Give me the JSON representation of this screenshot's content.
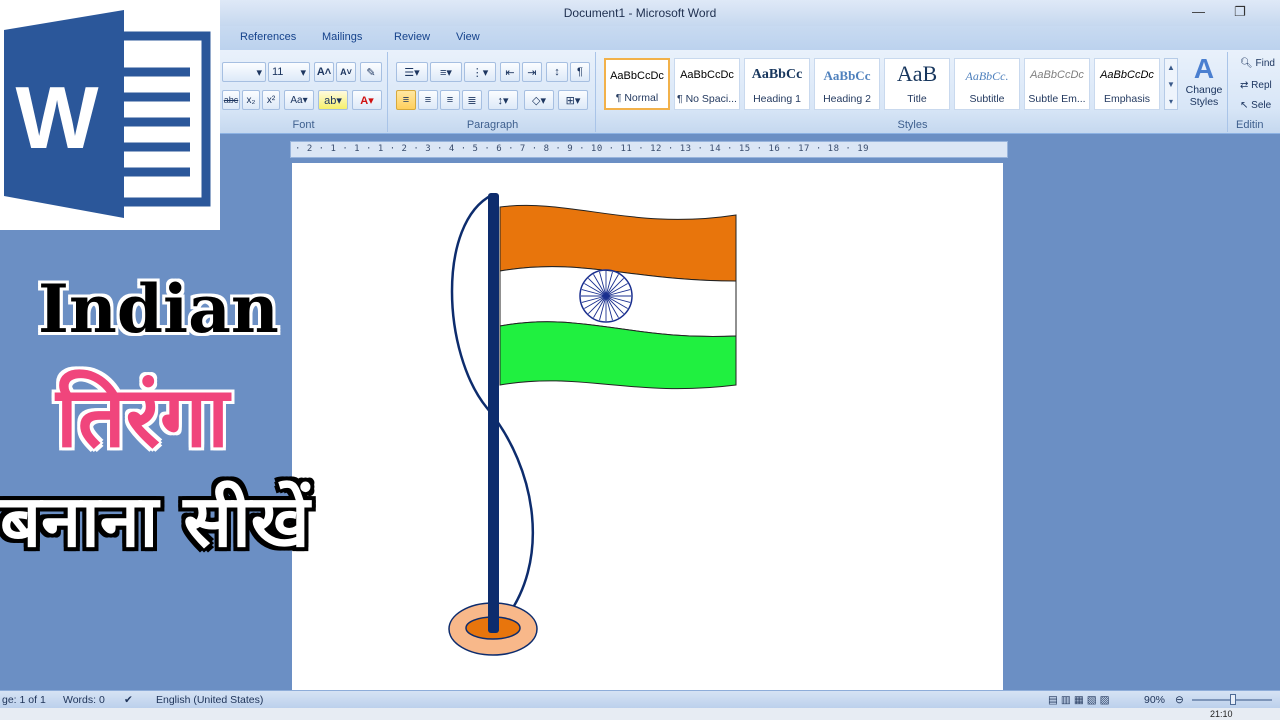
{
  "window": {
    "title": "Document1 - Microsoft Word"
  },
  "tabs": [
    "References",
    "Mailings",
    "Review",
    "View"
  ],
  "ribbon": {
    "font_size": "11",
    "font_label": "Font",
    "paragraph_label": "Paragraph",
    "styles_label": "Styles",
    "editing_label": "Editin",
    "styles": [
      {
        "sample": "AaBbCcDc",
        "name": "¶ Normal",
        "selected": true
      },
      {
        "sample": "AaBbCcDc",
        "name": "¶ No Spaci..."
      },
      {
        "sample": "AaBbCc",
        "name": "Heading 1"
      },
      {
        "sample": "AaBbCc",
        "name": "Heading 2"
      },
      {
        "sample": "AaB",
        "name": "Title"
      },
      {
        "sample": "AaBbCc.",
        "name": "Subtitle"
      },
      {
        "sample": "AaBbCcDc",
        "name": "Subtle Em..."
      },
      {
        "sample": "AaBbCcDc",
        "name": "Emphasis"
      }
    ],
    "change_styles": "Change Styles",
    "editing": {
      "find": "Find",
      "replace": "Repl",
      "select": "Sele"
    }
  },
  "ruler_text": "· 2 · 1 · 1 · 1 · 2 · 3 · 4 · 5 · 6 · 7 · 8 · 9 · 10 · 11 · 12 · 13 · 14 · 15 · 16 · 17 · 18 · 19",
  "overlay": {
    "line1": "Indian",
    "line2": "तिरंगा",
    "line3": "बनाना सीखें"
  },
  "logo": {
    "letter": "W"
  },
  "status": {
    "page": "ge: 1 of 1",
    "words": "Words: 0",
    "language": "English (United States)",
    "zoom": "90%",
    "time": "21:10"
  },
  "colors": {
    "saffron": "#e8750c",
    "green": "#20f040",
    "chakra": "#1a2f8f",
    "pole": "#0d2c6d"
  }
}
